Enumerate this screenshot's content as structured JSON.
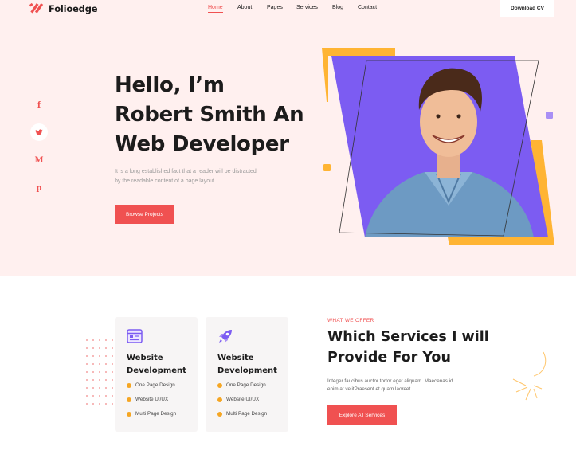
{
  "header": {
    "logo_text": "Folioedge",
    "nav": [
      "Home",
      "About",
      "Pages",
      "Services",
      "Blog",
      "Contact"
    ],
    "download_label": "Download CV"
  },
  "social": [
    {
      "icon": "facebook-icon",
      "glyph": "f"
    },
    {
      "icon": "twitter-icon",
      "glyph": "t"
    },
    {
      "icon": "gmail-icon",
      "glyph": "M"
    },
    {
      "icon": "pinterest-icon",
      "glyph": "p"
    }
  ],
  "hero": {
    "title_lines": [
      "Hello, I’m",
      "Robert Smith An",
      "Web Developer"
    ],
    "desc_lines": [
      "It is a long established fact that a reader will be distracted",
      "by the readable content of a page layout."
    ],
    "button_label": "Browse Projects"
  },
  "services": {
    "cards": [
      {
        "title_lines": [
          "Website",
          "Development"
        ],
        "icon": "browser-window-icon",
        "features": [
          "One Page Design",
          "Website UI/UX",
          "Multi Page Design"
        ]
      },
      {
        "title_lines": [
          "Website",
          "Development"
        ],
        "icon": "rocket-icon",
        "features": [
          "One Page Design",
          "Website UI/UX",
          "Multi Page Design"
        ]
      }
    ],
    "offer_label": "WHAT WE OFFER",
    "offer_title_lines": [
      "Which Services I will",
      "Provide For You"
    ],
    "offer_desc_lines": [
      "Integer faucibus auctor tortor eget aliquam. Maecenas id",
      "enim at velitPraesent et quam laoreet."
    ],
    "offer_button_label": "Explore All Services"
  },
  "colors": {
    "accent": "#f05151",
    "purple": "#7c5cf2",
    "orange": "#ffb433",
    "hero_bg": "#fff0ef"
  }
}
